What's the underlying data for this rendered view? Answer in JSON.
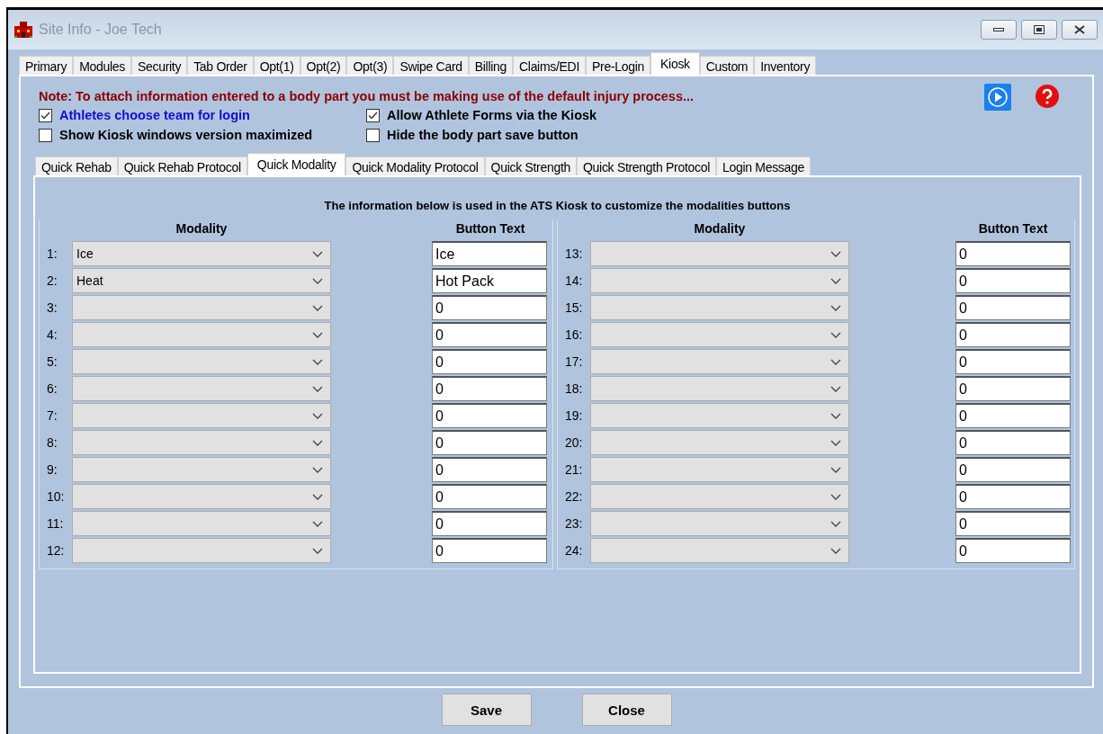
{
  "window": {
    "title": "Site Info - Joe Tech"
  },
  "tabs": [
    {
      "label": "Primary",
      "selected": false
    },
    {
      "label": "Modules",
      "selected": false
    },
    {
      "label": "Security",
      "selected": false
    },
    {
      "label": "Tab Order",
      "selected": false
    },
    {
      "label": "Opt(1)",
      "selected": false
    },
    {
      "label": "Opt(2)",
      "selected": false
    },
    {
      "label": "Opt(3)",
      "selected": false
    },
    {
      "label": "Swipe Card",
      "selected": false
    },
    {
      "label": "Billing",
      "selected": false
    },
    {
      "label": "Claims/EDI",
      "selected": false
    },
    {
      "label": "Pre-Login",
      "selected": false
    },
    {
      "label": "Kiosk",
      "selected": true
    },
    {
      "label": "Custom",
      "selected": false
    },
    {
      "label": "Inventory",
      "selected": false
    }
  ],
  "note": "Note:  To attach information entered to a body part you must be making use of the default injury process...",
  "options": [
    {
      "label": "Athletes choose team for login",
      "checked": true,
      "color": "#1010d0"
    },
    {
      "label": "Allow Athlete Forms via the Kiosk",
      "checked": true,
      "color": "#000000"
    },
    {
      "label": "Show Kiosk windows version maximized",
      "checked": false,
      "color": "#000000"
    },
    {
      "label": "Hide the body part save button",
      "checked": false,
      "color": "#000000"
    }
  ],
  "subtabs": [
    {
      "label": "Quick Rehab",
      "selected": false
    },
    {
      "label": "Quick Rehab Protocol",
      "selected": false
    },
    {
      "label": "Quick Modality",
      "selected": true
    },
    {
      "label": "Quick Modality Protocol",
      "selected": false
    },
    {
      "label": "Quick Strength",
      "selected": false
    },
    {
      "label": "Quick Strength Protocol",
      "selected": false
    },
    {
      "label": "Login Message",
      "selected": false
    }
  ],
  "description": "The information below is used in the ATS Kiosk to customize the modalities buttons",
  "groups": [
    {
      "modality_header": "Modality",
      "button_text_header": "Button Text",
      "rows": [
        {
          "number": "1:",
          "modality": "Ice",
          "button_text": "Ice"
        },
        {
          "number": "2:",
          "modality": "Heat",
          "button_text": "Hot Pack"
        },
        {
          "number": "3:",
          "button_text": "0"
        },
        {
          "number": "4:",
          "button_text": "0"
        },
        {
          "number": "5:",
          "button_text": "0"
        },
        {
          "number": "6:",
          "button_text": "0"
        },
        {
          "number": "7:",
          "button_text": "0"
        },
        {
          "number": "8:",
          "button_text": "0"
        },
        {
          "number": "9:",
          "button_text": "0"
        },
        {
          "number": "10:",
          "button_text": "0"
        },
        {
          "number": "11:",
          "button_text": "0"
        },
        {
          "number": "12:",
          "button_text": "0"
        }
      ]
    },
    {
      "modality_header": "Modality",
      "button_text_header": "Button Text",
      "rows": [
        {
          "number": "13:",
          "button_text": "0"
        },
        {
          "number": "14:",
          "button_text": "0"
        },
        {
          "number": "15:",
          "button_text": "0"
        },
        {
          "number": "16:",
          "button_text": "0"
        },
        {
          "number": "17:",
          "button_text": "0"
        },
        {
          "number": "18:",
          "button_text": "0"
        },
        {
          "number": "19:",
          "button_text": "0"
        },
        {
          "number": "20:",
          "button_text": "0"
        },
        {
          "number": "21:",
          "button_text": "0"
        },
        {
          "number": "22:",
          "button_text": "0"
        },
        {
          "number": "23:",
          "button_text": "0"
        },
        {
          "number": "24:",
          "button_text": "0"
        }
      ]
    }
  ],
  "buttons": [
    "Save",
    "Close"
  ]
}
